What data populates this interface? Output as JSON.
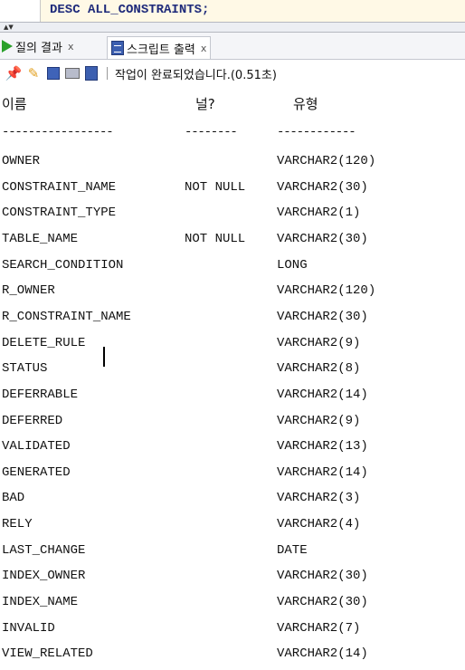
{
  "editor": {
    "code_line": "DESC ALL_CONSTRAINTS;"
  },
  "tabs": [
    {
      "label": "질의 결과",
      "close": "x",
      "icon": "play-icon"
    },
    {
      "label": "스크립트 출력",
      "close": "x",
      "icon": "script-icon"
    }
  ],
  "toolbar": {
    "icons": [
      "pin-icon",
      "eraser-icon",
      "save-icon",
      "print-icon",
      "doc-icon"
    ],
    "status": "작업이 완료되었습니다.(0.51초)"
  },
  "output": {
    "headers": {
      "name": "이름",
      "null": "널?",
      "type": "유형"
    },
    "dashes": {
      "name": "-----------------",
      "null": "--------",
      "type": "------------"
    },
    "rows": [
      {
        "name": "OWNER",
        "null": "",
        "type": "VARCHAR2(120)"
      },
      {
        "name": "CONSTRAINT_NAME",
        "null": "NOT NULL",
        "type": "VARCHAR2(30)"
      },
      {
        "name": "CONSTRAINT_TYPE",
        "null": "",
        "type": "VARCHAR2(1)"
      },
      {
        "name": "TABLE_NAME",
        "null": "NOT NULL",
        "type": "VARCHAR2(30)"
      },
      {
        "name": "SEARCH_CONDITION",
        "null": "",
        "type": "LONG"
      },
      {
        "name": "R_OWNER",
        "null": "",
        "type": "VARCHAR2(120)"
      },
      {
        "name": "R_CONSTRAINT_NAME",
        "null": "",
        "type": "VARCHAR2(30)"
      },
      {
        "name": "DELETE_RULE",
        "null": "",
        "type": "VARCHAR2(9)"
      },
      {
        "name": "STATUS",
        "null": "",
        "type": "VARCHAR2(8)"
      },
      {
        "name": "DEFERRABLE",
        "null": "",
        "type": "VARCHAR2(14)"
      },
      {
        "name": "DEFERRED",
        "null": "",
        "type": "VARCHAR2(9)"
      },
      {
        "name": "VALIDATED",
        "null": "",
        "type": "VARCHAR2(13)"
      },
      {
        "name": "GENERATED",
        "null": "",
        "type": "VARCHAR2(14)"
      },
      {
        "name": "BAD",
        "null": "",
        "type": "VARCHAR2(3)"
      },
      {
        "name": "RELY",
        "null": "",
        "type": "VARCHAR2(4)"
      },
      {
        "name": "LAST_CHANGE",
        "null": "",
        "type": "DATE"
      },
      {
        "name": "INDEX_OWNER",
        "null": "",
        "type": "VARCHAR2(30)"
      },
      {
        "name": "INDEX_NAME",
        "null": "",
        "type": "VARCHAR2(30)"
      },
      {
        "name": "INVALID",
        "null": "",
        "type": "VARCHAR2(7)"
      },
      {
        "name": "VIEW_RELATED",
        "null": "",
        "type": "VARCHAR2(14)"
      }
    ]
  },
  "colors": {
    "editor_bg": "#fff9e6",
    "code_text": "#1e2a7a",
    "run_icon": "#2aa02a"
  }
}
